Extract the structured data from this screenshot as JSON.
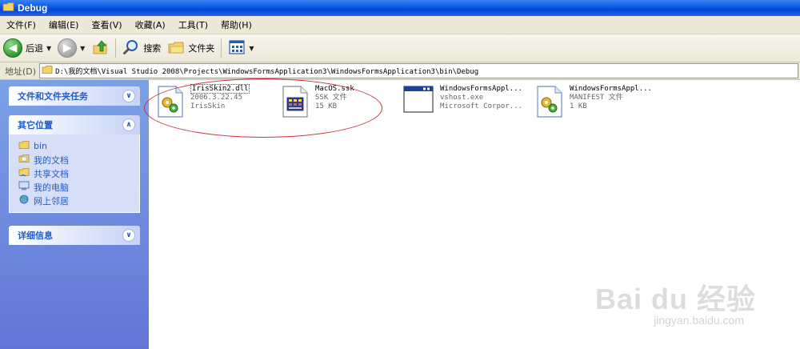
{
  "window": {
    "title": "Debug"
  },
  "menu": [
    "文件(F)",
    "编辑(E)",
    "查看(V)",
    "收藏(A)",
    "工具(T)",
    "帮助(H)"
  ],
  "toolbar": {
    "back_label": "后退",
    "search_label": "搜索",
    "folders_label": "文件夹"
  },
  "address": {
    "label": "地址(D)",
    "path": "D:\\我的文档\\Visual Studio 2008\\Projects\\WindowsFormsApplication3\\WindowsFormsApplication3\\bin\\Debug"
  },
  "tasks": {
    "file_tasks": {
      "title": "文件和文件夹任务"
    },
    "other_places": {
      "title": "其它位置",
      "items": [
        {
          "label": "bin",
          "icon": "folder-icon"
        },
        {
          "label": "我的文档",
          "icon": "my-documents-icon"
        },
        {
          "label": "共享文档",
          "icon": "shared-folder-icon"
        },
        {
          "label": "我的电脑",
          "icon": "my-computer-icon"
        },
        {
          "label": "网上邻居",
          "icon": "network-icon"
        }
      ]
    },
    "details": {
      "title": "详细信息"
    }
  },
  "files": [
    {
      "name": "IrisSkin2.dll",
      "line2": "2006.3.22.45",
      "line3": "IrisSkin",
      "icon": "dll-gear-icon"
    },
    {
      "name": "MacOS.ssk",
      "line2": "SSK 文件",
      "line3": "15 KB",
      "icon": "ssk-file-icon"
    },
    {
      "name": "WindowsFormsAppl...",
      "line2": "vshost.exe",
      "line3": "Microsoft Corpor...",
      "icon": "exe-window-icon"
    },
    {
      "name": "WindowsFormsAppl...",
      "line2": "MANIFEST 文件",
      "line3": "1 KB",
      "icon": "manifest-gear-icon"
    }
  ],
  "watermark": {
    "main": "Bai du 经验",
    "sub": "jingyan.baidu.com"
  },
  "colors": {
    "title_bar": "#0a5ae0",
    "task_pane": "#6e8ddd",
    "task_link": "#215dc6",
    "annotation": "#c8323a"
  }
}
